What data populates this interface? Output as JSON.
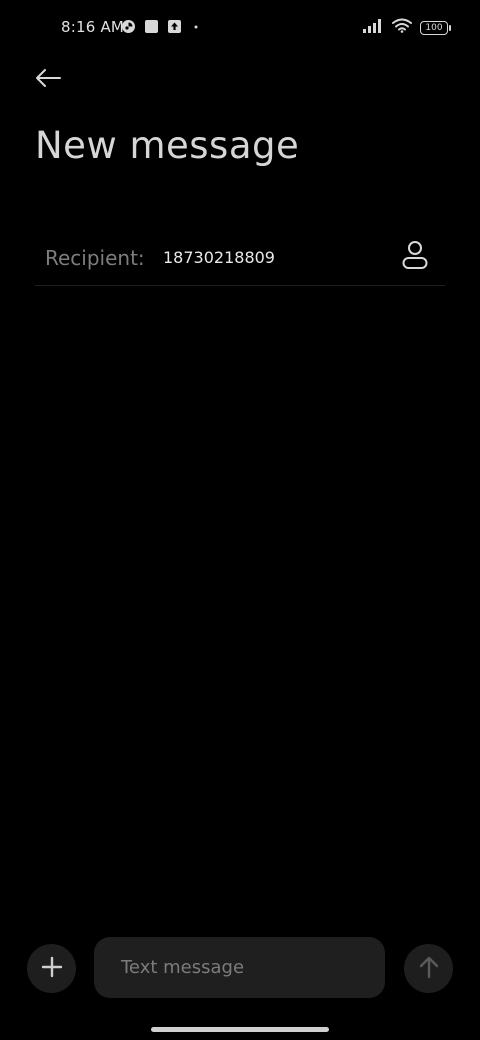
{
  "status_bar": {
    "time": "8:16 AM",
    "battery": "100",
    "icons_left": [
      "app-notification-icon",
      "square-notification-icon",
      "upload-notification-icon",
      "dot-icon"
    ],
    "icons_right": [
      "signal-icon",
      "wifi-icon",
      "battery-icon"
    ]
  },
  "header": {
    "back_icon": "arrow-left-icon",
    "title": "New message"
  },
  "recipient": {
    "label": "Recipient:",
    "value": "18730218809",
    "contact_icon": "person-icon"
  },
  "composer": {
    "add_icon": "plus-icon",
    "placeholder": "Text message",
    "value": "",
    "send_icon": "arrow-up-icon"
  },
  "colors": {
    "background": "#000000",
    "surface": "#1f1f1f",
    "text_primary": "#e6e6e6",
    "text_secondary": "#7d7d7d"
  }
}
